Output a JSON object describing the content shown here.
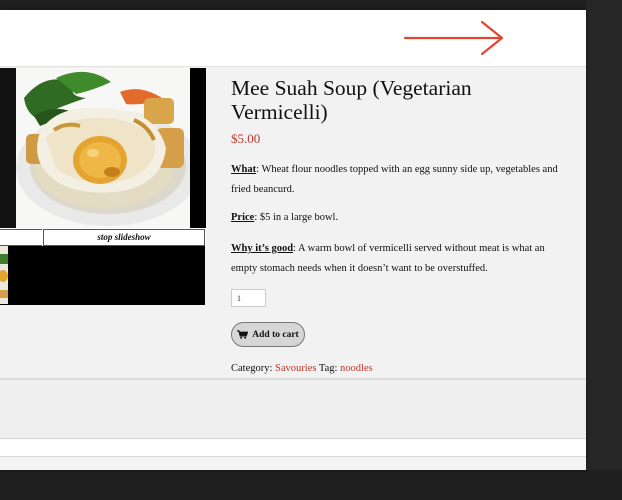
{
  "product": {
    "title": "Mee Suah Soup (Vegetarian Vermicelli)",
    "price": "$5.00",
    "what_label": "What",
    "what_text": ":  Wheat flour noodles topped with an egg sunny side up, vegetables and fried beancurd.",
    "price_label": "Price",
    "price_text": ": $5 in a large bowl.",
    "why_label": "Why it’s good",
    "why_text": ":   A warm bowl of vermicelli served without meat is what an empty stomach needs when it doesn’t want to be overstuffed.",
    "quantity": "1",
    "add_to_cart_label": "Add to cart",
    "category_label": "Category:",
    "category_value": "Savouries",
    "tag_label": "Tag:",
    "tag_value": "noodles"
  },
  "gallery": {
    "stop_slideshow_label": "stop slideshow"
  },
  "colors": {
    "accent_red": "#c0362c",
    "annotation_arrow": "#e2452f"
  },
  "icons": {
    "cart": "shopping-cart-icon",
    "arrow": "right-arrow-annotation"
  }
}
